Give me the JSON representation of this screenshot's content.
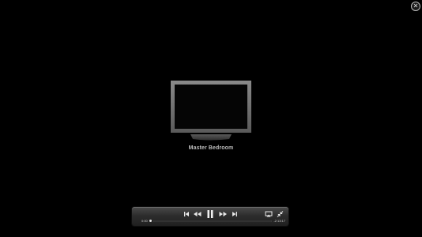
{
  "close": {
    "glyph": "✕",
    "icon": "close-icon"
  },
  "device": {
    "name": "Master Bedroom",
    "icon": "tv-icon"
  },
  "controller": {
    "elapsed": "0:00",
    "remaining": "-2:13:17",
    "progress_fraction": 0.0,
    "buttons": [
      {
        "name": "skip-back",
        "icon": "skip-back-icon"
      },
      {
        "name": "rewind",
        "icon": "rewind-icon"
      },
      {
        "name": "pause",
        "icon": "pause-icon"
      },
      {
        "name": "fast-forward",
        "icon": "fast-forward-icon"
      },
      {
        "name": "skip-forward",
        "icon": "skip-forward-icon"
      },
      {
        "name": "airplay",
        "icon": "airplay-icon"
      },
      {
        "name": "exit-fullscreen",
        "icon": "exit-fullscreen-icon"
      }
    ]
  },
  "colors": {
    "background": "#000000",
    "label": "#bdbdbd",
    "controller_top": "#4a4a4a",
    "controller_bottom": "#1f1f1f"
  }
}
